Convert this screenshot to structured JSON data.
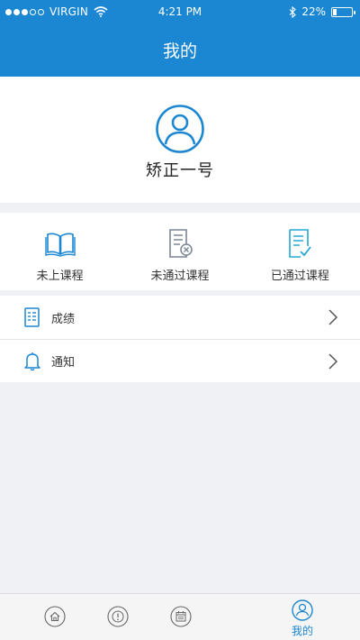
{
  "status_bar": {
    "carrier": "VIRGIN",
    "time": "4:21 PM",
    "battery": "22%",
    "battery_level": 0.22
  },
  "header": {
    "title": "我的"
  },
  "profile": {
    "name": "矫正一号"
  },
  "courses": [
    {
      "label": "未上课程",
      "icon": "open-book-icon"
    },
    {
      "label": "未通过课程",
      "icon": "document-x-icon"
    },
    {
      "label": "已通过课程",
      "icon": "document-check-icon"
    }
  ],
  "menu": [
    {
      "label": "成绩",
      "icon": "report-card-icon"
    },
    {
      "label": "通知",
      "icon": "bell-icon"
    }
  ],
  "tabbar": {
    "tabs": [
      {
        "icon": "home-icon",
        "label": ""
      },
      {
        "icon": "alert-icon",
        "label": ""
      },
      {
        "icon": "calendar-icon",
        "label": ""
      },
      {
        "icon": "profile-icon",
        "label": "我的"
      }
    ],
    "active_index": 3
  },
  "colors": {
    "primary": "#1b86d1",
    "background": "#eff1f4"
  }
}
